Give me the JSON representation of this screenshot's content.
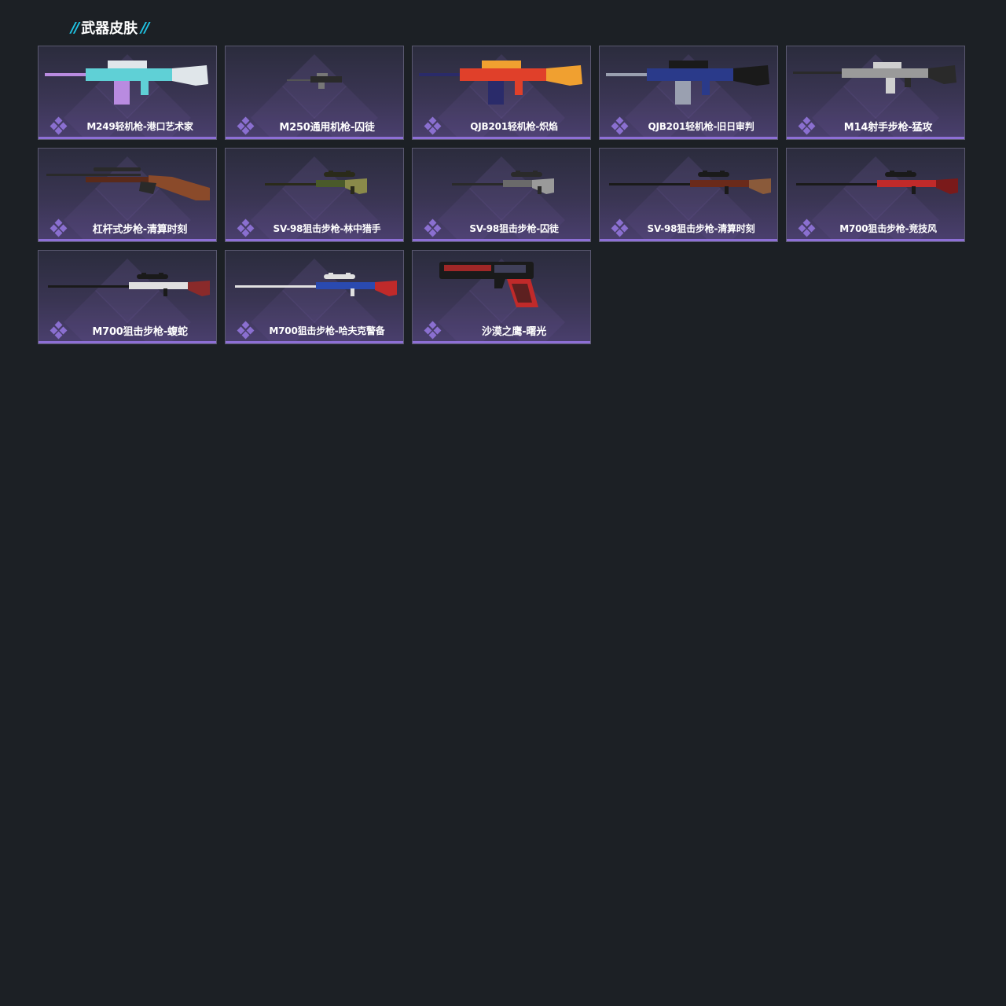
{
  "section": {
    "title": "武器皮肤",
    "accent_color": "#1fc6e6"
  },
  "rarity_color": "#8a6fd0",
  "skins": [
    {
      "name": "M249轻机枪-港口艺术家",
      "icon": "machine-gun-icon",
      "palette": [
        "#5fd0d6",
        "#b98be0",
        "#e0e6ea"
      ]
    },
    {
      "name": "M250通用机枪-囚徒",
      "icon": "machine-gun-icon",
      "palette": [
        "#2a2a2a",
        "#555555",
        "#777777"
      ]
    },
    {
      "name": "QJB201轻机枪-炽焰",
      "icon": "machine-gun-icon",
      "palette": [
        "#e0402a",
        "#2a2b6a",
        "#f0a030"
      ]
    },
    {
      "name": "QJB201轻机枪-旧日审判",
      "icon": "machine-gun-icon",
      "palette": [
        "#2a3a8a",
        "#9aa0b0",
        "#1a1a1a"
      ]
    },
    {
      "name": "M14射手步枪-猛攻",
      "icon": "rifle-icon",
      "palette": [
        "#9a9a9a",
        "#2a2a2a",
        "#cfcfcf"
      ]
    },
    {
      "name": "杠杆式步枪-清算时刻",
      "icon": "lever-rifle-icon",
      "palette": [
        "#5a2a1a",
        "#2a2a2a",
        "#8a4a2a"
      ]
    },
    {
      "name": "SV-98狙击步枪-林中猎手",
      "icon": "sniper-rifle-icon",
      "palette": [
        "#4a5a2a",
        "#2a2a1a",
        "#8a8a4a"
      ]
    },
    {
      "name": "SV-98狙击步枪-囚徒",
      "icon": "sniper-rifle-icon",
      "palette": [
        "#6a6a6a",
        "#2a2a2a",
        "#9a9a9a"
      ]
    },
    {
      "name": "SV-98狙击步枪-清算时刻",
      "icon": "sniper-rifle-icon",
      "palette": [
        "#6a2a1a",
        "#1a1a1a",
        "#8a5a3a"
      ]
    },
    {
      "name": "M700狙击步枪-竞技风",
      "icon": "sniper-rifle-icon",
      "palette": [
        "#c02a2a",
        "#1a1a1a",
        "#7a1a1a"
      ]
    },
    {
      "name": "M700狙击步枪-蝮蛇",
      "icon": "sniper-rifle-icon",
      "palette": [
        "#e0e0e0",
        "#1a1a1a",
        "#8a2a2a"
      ]
    },
    {
      "name": "M700狙击步枪-哈夫克警备",
      "icon": "sniper-rifle-icon",
      "palette": [
        "#2a4ab0",
        "#e0e0e0",
        "#c02a2a"
      ]
    },
    {
      "name": "沙漠之鹰-曙光",
      "icon": "pistol-icon",
      "palette": [
        "#1a1a1a",
        "#c02a2a",
        "#4a4a6a"
      ]
    }
  ]
}
